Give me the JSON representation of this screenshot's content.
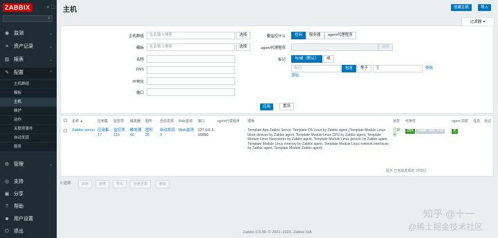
{
  "sidebar": {
    "logo": "ZABBIX",
    "nav": [
      {
        "label": "监测",
        "icon": "eye-icon"
      },
      {
        "label": "资产记录",
        "icon": "list-icon"
      },
      {
        "label": "报表",
        "icon": "chart-icon"
      },
      {
        "label": "配置",
        "icon": "wrench-icon"
      }
    ],
    "config_items": [
      "主机群组",
      "模板",
      "主机",
      "维护",
      "动作",
      "关联项事件",
      "自动发现",
      "服务"
    ],
    "nav_bottom": [
      {
        "label": "管理",
        "icon": "gear-icon"
      },
      {
        "label": "支持",
        "icon": "support-icon"
      },
      {
        "label": "分享",
        "icon": "share-icon"
      },
      {
        "label": "帮助",
        "icon": "help-icon"
      },
      {
        "label": "用户设置",
        "icon": "user-icon"
      },
      {
        "label": "退出",
        "icon": "power-icon"
      }
    ]
  },
  "header": {
    "title": "主机",
    "create_button": "创建主机",
    "import_button": "导入",
    "filter_tab": "过滤器"
  },
  "filter": {
    "host_groups_label": "主机群组",
    "host_groups_placeholder": "在此输入搜索",
    "select_label": "选择",
    "templates_label": "模板",
    "templates_placeholder": "在此输入搜索",
    "name_label": "名称",
    "dns_label": "DNS",
    "ip_label": "IP地址",
    "port_label": "端口",
    "monitored_by_label": "要监控什么",
    "monitored_by_options": [
      "任何",
      "服务器",
      "agent代理程序"
    ],
    "proxy_label": "agent代理程序",
    "proxy_select": "选择",
    "tags_label": "标记",
    "tag_mode_options": [
      "与/或（默认）",
      "或"
    ],
    "tag_placeholder": "标记",
    "tag_operator_options": [
      "包含",
      "等于"
    ],
    "value_placeholder": "值",
    "remove_label": "移除",
    "add_label": "添加",
    "apply_button": "应用",
    "reset_button": "重设"
  },
  "table": {
    "columns": [
      "名称",
      "应用集",
      "监控项",
      "触发器",
      "图形",
      "自动发现",
      "Web监测",
      "接口",
      "agent代理程序",
      "模板",
      "状态",
      "可用性",
      "agent 加密",
      "信息",
      "标记"
    ],
    "row": {
      "name": "Zabbix server",
      "applications": "应用集",
      "applications_count": "17",
      "items": "监控项",
      "items_count": "119",
      "triggers": "触发器",
      "triggers_count": "66",
      "graphs": "图形",
      "graphs_count": "26",
      "discovery": "自动发现",
      "discovery_count": "3",
      "web": "Web监测",
      "interface": "127.0.0.1: 10050",
      "templates": "Template App Zabbix Server, Template OS Linux by Zabbix agent (Template Module Linux block devices by Zabbix agent, Template Module Linux CPU by Zabbix agent, Template Module Linux filesystems by Zabbix agent, Template Module Linux generic by Zabbix agent, Template Module Linux memory by Zabbix agent, Template Module Linux network interfaces by Zabbix agent, Template Module Zabbix agent)",
      "status": "已启用",
      "availability": [
        "ZBX",
        "SNMP",
        "JMX",
        "IPMI"
      ],
      "encryption": "无"
    },
    "summary": "显示 已自动发现的 1中的1"
  },
  "bottom_bar": {
    "selected": "0 选择",
    "buttons": [
      "启用",
      "禁用",
      "导出",
      "批量更新",
      "删除"
    ]
  },
  "footer": "Zabbix 6.0.39. © 2001–2023, Zabbix SIA",
  "watermark": [
    "知乎 @十一",
    "@稀土掘金技术社区"
  ],
  "colors": {
    "sidebar": "#1f2c33",
    "accent": "#0275b8",
    "logo": "#d40000",
    "enabled": "#3b9a2b",
    "zbx": "#3b9a2b"
  }
}
